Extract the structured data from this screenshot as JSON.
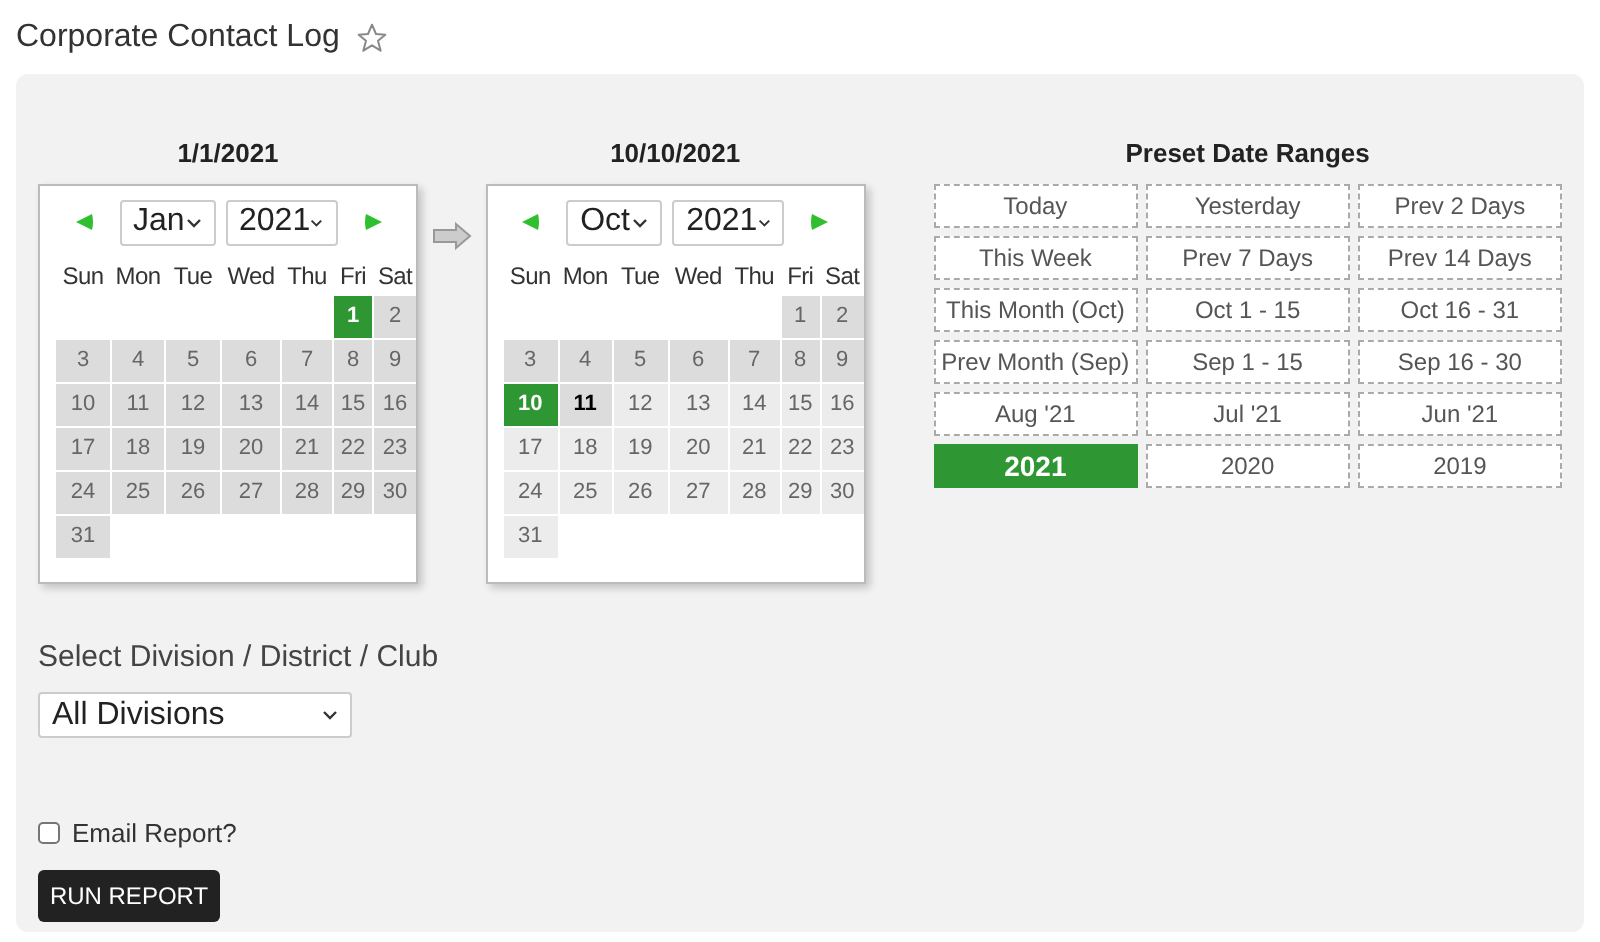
{
  "page_title": "Corporate Contact Log",
  "calendars": [
    {
      "title": "1/1/2021",
      "month": "Jan",
      "year": "2021",
      "weekdays": [
        "Sun",
        "Mon",
        "Tue",
        "Wed",
        "Thu",
        "Fri",
        "Sat"
      ],
      "weeks": [
        [
          {
            "d": "1",
            "selected": true,
            "in_range": true,
            "today": false
          },
          {
            "d": "2",
            "selected": false,
            "in_range": true,
            "today": false
          }
        ],
        [
          {
            "d": "3",
            "selected": false,
            "in_range": true,
            "today": false
          },
          {
            "d": "4",
            "selected": false,
            "in_range": true,
            "today": false
          },
          {
            "d": "5",
            "selected": false,
            "in_range": true,
            "today": false
          },
          {
            "d": "6",
            "selected": false,
            "in_range": true,
            "today": false
          },
          {
            "d": "7",
            "selected": false,
            "in_range": true,
            "today": false
          },
          {
            "d": "8",
            "selected": false,
            "in_range": true,
            "today": false
          },
          {
            "d": "9",
            "selected": false,
            "in_range": true,
            "today": false
          }
        ],
        [
          {
            "d": "10",
            "selected": false,
            "in_range": true,
            "today": false
          },
          {
            "d": "11",
            "selected": false,
            "in_range": true,
            "today": false
          },
          {
            "d": "12",
            "selected": false,
            "in_range": true,
            "today": false
          },
          {
            "d": "13",
            "selected": false,
            "in_range": true,
            "today": false
          },
          {
            "d": "14",
            "selected": false,
            "in_range": true,
            "today": false
          },
          {
            "d": "15",
            "selected": false,
            "in_range": true,
            "today": false
          },
          {
            "d": "16",
            "selected": false,
            "in_range": true,
            "today": false
          }
        ],
        [
          {
            "d": "17",
            "selected": false,
            "in_range": true,
            "today": false
          },
          {
            "d": "18",
            "selected": false,
            "in_range": true,
            "today": false
          },
          {
            "d": "19",
            "selected": false,
            "in_range": true,
            "today": false
          },
          {
            "d": "20",
            "selected": false,
            "in_range": true,
            "today": false
          },
          {
            "d": "21",
            "selected": false,
            "in_range": true,
            "today": false
          },
          {
            "d": "22",
            "selected": false,
            "in_range": true,
            "today": false
          },
          {
            "d": "23",
            "selected": false,
            "in_range": true,
            "today": false
          }
        ],
        [
          {
            "d": "24",
            "selected": false,
            "in_range": true,
            "today": false
          },
          {
            "d": "25",
            "selected": false,
            "in_range": true,
            "today": false
          },
          {
            "d": "26",
            "selected": false,
            "in_range": true,
            "today": false
          },
          {
            "d": "27",
            "selected": false,
            "in_range": true,
            "today": false
          },
          {
            "d": "28",
            "selected": false,
            "in_range": true,
            "today": false
          },
          {
            "d": "29",
            "selected": false,
            "in_range": true,
            "today": false
          },
          {
            "d": "30",
            "selected": false,
            "in_range": true,
            "today": false
          }
        ],
        [
          {
            "d": "31",
            "selected": false,
            "in_range": true,
            "today": false
          }
        ]
      ]
    },
    {
      "title": "10/10/2021",
      "month": "Oct",
      "year": "2021",
      "weekdays": [
        "Sun",
        "Mon",
        "Tue",
        "Wed",
        "Thu",
        "Fri",
        "Sat"
      ],
      "weeks": [
        [
          {
            "d": "1",
            "selected": false,
            "in_range": true,
            "today": false
          },
          {
            "d": "2",
            "selected": false,
            "in_range": true,
            "today": false
          }
        ],
        [
          {
            "d": "3",
            "selected": false,
            "in_range": true,
            "today": false
          },
          {
            "d": "4",
            "selected": false,
            "in_range": true,
            "today": false
          },
          {
            "d": "5",
            "selected": false,
            "in_range": true,
            "today": false
          },
          {
            "d": "6",
            "selected": false,
            "in_range": true,
            "today": false
          },
          {
            "d": "7",
            "selected": false,
            "in_range": true,
            "today": false
          },
          {
            "d": "8",
            "selected": false,
            "in_range": true,
            "today": false
          },
          {
            "d": "9",
            "selected": false,
            "in_range": true,
            "today": false
          }
        ],
        [
          {
            "d": "10",
            "selected": true,
            "in_range": true,
            "today": false
          },
          {
            "d": "11",
            "selected": false,
            "in_range": false,
            "today": true
          },
          {
            "d": "12",
            "selected": false,
            "in_range": false,
            "today": false
          },
          {
            "d": "13",
            "selected": false,
            "in_range": false,
            "today": false
          },
          {
            "d": "14",
            "selected": false,
            "in_range": false,
            "today": false
          },
          {
            "d": "15",
            "selected": false,
            "in_range": false,
            "today": false
          },
          {
            "d": "16",
            "selected": false,
            "in_range": false,
            "today": false
          }
        ],
        [
          {
            "d": "17",
            "selected": false,
            "in_range": false,
            "today": false
          },
          {
            "d": "18",
            "selected": false,
            "in_range": false,
            "today": false
          },
          {
            "d": "19",
            "selected": false,
            "in_range": false,
            "today": false
          },
          {
            "d": "20",
            "selected": false,
            "in_range": false,
            "today": false
          },
          {
            "d": "21",
            "selected": false,
            "in_range": false,
            "today": false
          },
          {
            "d": "22",
            "selected": false,
            "in_range": false,
            "today": false
          },
          {
            "d": "23",
            "selected": false,
            "in_range": false,
            "today": false
          }
        ],
        [
          {
            "d": "24",
            "selected": false,
            "in_range": false,
            "today": false
          },
          {
            "d": "25",
            "selected": false,
            "in_range": false,
            "today": false
          },
          {
            "d": "26",
            "selected": false,
            "in_range": false,
            "today": false
          },
          {
            "d": "27",
            "selected": false,
            "in_range": false,
            "today": false
          },
          {
            "d": "28",
            "selected": false,
            "in_range": false,
            "today": false
          },
          {
            "d": "29",
            "selected": false,
            "in_range": false,
            "today": false
          },
          {
            "d": "30",
            "selected": false,
            "in_range": false,
            "today": false
          }
        ],
        [
          {
            "d": "31",
            "selected": false,
            "in_range": false,
            "today": false
          }
        ]
      ]
    }
  ],
  "presets": {
    "title": "Preset Date Ranges",
    "items": [
      {
        "label": "Today",
        "selected": false
      },
      {
        "label": "Yesterday",
        "selected": false
      },
      {
        "label": "Prev 2 Days",
        "selected": false
      },
      {
        "label": "This Week",
        "selected": false
      },
      {
        "label": "Prev 7 Days",
        "selected": false
      },
      {
        "label": "Prev 14 Days",
        "selected": false
      },
      {
        "label": "This Month (Oct)",
        "selected": false
      },
      {
        "label": "Oct 1 - 15",
        "selected": false
      },
      {
        "label": "Oct 16 - 31",
        "selected": false
      },
      {
        "label": "Prev Month (Sep)",
        "selected": false
      },
      {
        "label": "Sep 1 - 15",
        "selected": false
      },
      {
        "label": "Sep 16 - 30",
        "selected": false
      },
      {
        "label": "Aug '21",
        "selected": false
      },
      {
        "label": "Jul '21",
        "selected": false
      },
      {
        "label": "Jun '21",
        "selected": false
      },
      {
        "label": "2021",
        "selected": true
      },
      {
        "label": "2020",
        "selected": false
      },
      {
        "label": "2019",
        "selected": false
      }
    ]
  },
  "division": {
    "label": "Select Division / District / Club",
    "value": "All Divisions"
  },
  "email_report": {
    "label": "Email Report?",
    "checked": false
  },
  "run_button": "RUN REPORT"
}
